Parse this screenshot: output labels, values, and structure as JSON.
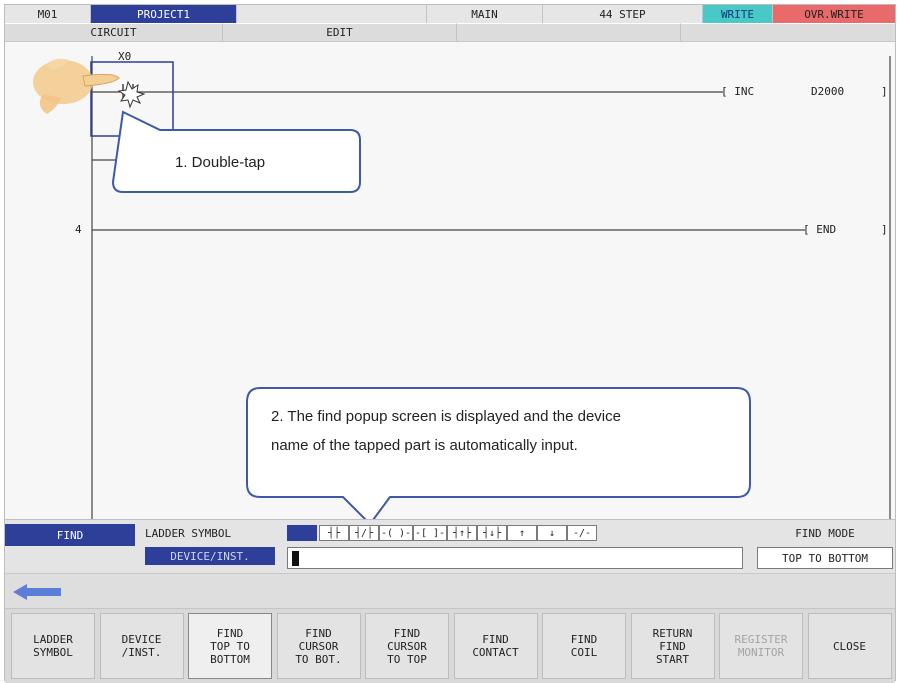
{
  "status_bar": {
    "station": "M01",
    "project": "PROJECT1",
    "program": "MAIN",
    "steps": "44 STEP",
    "mode": "WRITE",
    "overwrite": "OVR.WRITE"
  },
  "tabs": {
    "circuit": "CIRCUIT",
    "edit": "EDIT"
  },
  "ladder": {
    "contact_device": "X0",
    "coil1_instruction": "[ INC",
    "coil1_operand": "D2000",
    "coil1_end": "]",
    "rung2_step": "4",
    "coil2_instruction": "[ END",
    "coil2_end": "]"
  },
  "callouts": {
    "step1": "1. Double-tap",
    "step2_line1": "2. The find popup screen is displayed and the device",
    "step2_line2": "name of the tapped part is automatically input."
  },
  "find_bar": {
    "find_label": "FIND",
    "ladder_symbol_label": "LADDER SYMBOL",
    "device_inst_label": "DEVICE/INST.",
    "device_input_value": "",
    "find_mode_label": "FIND MODE",
    "find_mode_value": "TOP TO BOTTOM",
    "symbols": [
      "┤├",
      "┤/├",
      "-( )-",
      "-[ ]-",
      "┤↑├",
      "┤↓├",
      "↑",
      "↓",
      "-/-"
    ]
  },
  "function_keys": [
    "LADDER\nSYMBOL",
    "DEVICE\n/INST.",
    "FIND\nTOP TO\nBOTTOM",
    "FIND\nCURSOR\nTO BOT.",
    "FIND\nCURSOR\nTO TOP",
    "FIND\nCONTACT",
    "FIND\nCOIL",
    "RETURN\nFIND\nSTART",
    "REGISTER\nMONITOR",
    "CLOSE"
  ],
  "colors": {
    "accent_blue": "#2e3f9a",
    "write_cyan": "#49c8c8",
    "overwrite_red": "#e86a6a",
    "callout_border": "#3d5aa8"
  }
}
